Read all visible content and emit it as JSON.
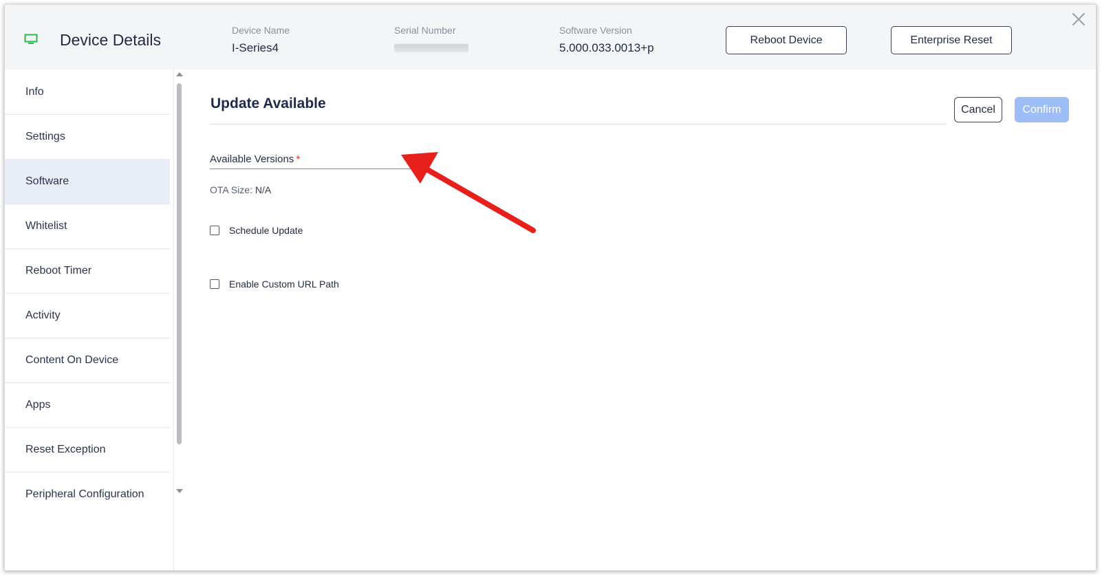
{
  "header": {
    "title": "Device Details",
    "device_name_label": "Device Name",
    "device_name_value": "I-Series4",
    "serial_label": "Serial Number",
    "version_label": "Software Version",
    "version_value": "5.000.033.0013+p",
    "reboot_label": "Reboot Device",
    "enterprise_reset_label": "Enterprise Reset"
  },
  "sidebar": {
    "items": [
      {
        "label": "Info"
      },
      {
        "label": "Settings"
      },
      {
        "label": "Software"
      },
      {
        "label": "Whitelist"
      },
      {
        "label": "Reboot Timer"
      },
      {
        "label": "Activity"
      },
      {
        "label": "Content On Device"
      },
      {
        "label": "Apps"
      },
      {
        "label": "Reset Exception"
      },
      {
        "label": "Peripheral Configuration"
      }
    ],
    "active": "Software"
  },
  "main": {
    "title": "Update Available",
    "cancel_label": "Cancel",
    "confirm_label": "Confirm",
    "select_label": "Available Versions",
    "required_mark": "*",
    "ota_label": "OTA Size:",
    "ota_value": "N/A",
    "schedule_label": "Schedule Update",
    "custom_url_label": "Enable Custom URL Path"
  },
  "colors": {
    "accent": "#3aa0d6",
    "confirm_disabled": "#9dbdf7",
    "active_nav": "#e8edf8",
    "device_icon": "#2db84d",
    "annotation_arrow": "#e8201c"
  },
  "icons": {
    "device": "monitor-icon",
    "close": "close-icon",
    "dropdown": "chevron-down-icon",
    "annotation": "arrow-icon"
  }
}
